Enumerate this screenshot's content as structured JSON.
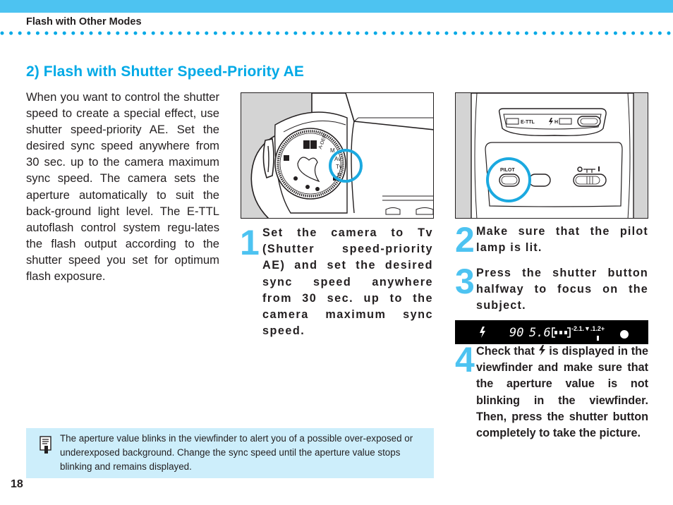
{
  "header": {
    "section": "Flash with Other Modes",
    "accent_color": "#4dc3f1",
    "dot_color": "#00a9e6"
  },
  "page_title": "2) Flash with Shutter Speed-Priority AE",
  "intro": "When you want to control the shutter speed to create a special effect, use shutter speed-priority AE. Set the desired sync speed anywhere from 30 sec. up to the camera maximum sync speed. The camera sets the aperture automatically to suit the back-ground light level. The E-TTL autoflash control system regu-lates the flash output according to the shutter speed you set for optimum flash exposure.",
  "figure1": {
    "mode_dial_labels": [
      "A-DEP",
      "M",
      "Av",
      "Tv",
      "P"
    ],
    "highlight": "Tv"
  },
  "figure2": {
    "labels": {
      "ettl": "E-TTL",
      "flash_h": "H",
      "pilot": "PILOT",
      "switch_off": "O",
      "switch_on": "I"
    }
  },
  "steps": [
    {
      "number": "1",
      "text": "Set the camera to Tv (Shutter speed-priority AE) and set the desired sync speed anywhere from 30 sec. up to the camera maximum sync speed."
    },
    {
      "number": "2",
      "text": "Make sure that the pilot lamp is lit."
    },
    {
      "number": "3",
      "text": "Press the shutter button halfway to focus on the subject."
    },
    {
      "number": "4",
      "text_before": "Check that",
      "text_after": "is displayed in the viewfinder and make sure that the aperture value is not blinking in the viewfinder. Then, press the shutter button completely to take the picture."
    }
  ],
  "viewfinder": {
    "shutter_speed": "90",
    "aperture": "5.6",
    "scale": "-2.1.▼.1.2+",
    "flash_icon": "flash-icon"
  },
  "note": {
    "icon": "memo-icon",
    "text": "The aperture value blinks in the viewfinder to alert you of a possible over-exposed or underexposed background.  Change the sync speed until the aperture value stops blinking and remains displayed."
  },
  "page_number": "18"
}
